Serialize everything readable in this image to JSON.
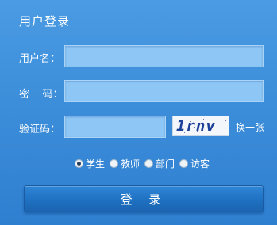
{
  "form": {
    "title": "用户登录",
    "username_label": "用户名：",
    "username_value": "",
    "password_label": "密    码：",
    "password_value": "",
    "captcha_label": "验证码：",
    "captcha_value": "",
    "captcha_text": "1rnv",
    "refresh_label": "换一张",
    "roles": [
      {
        "label": "学生",
        "checked": true
      },
      {
        "label": "教师",
        "checked": false
      },
      {
        "label": "部门",
        "checked": false
      },
      {
        "label": "访客",
        "checked": false
      }
    ],
    "login_label": "登 录"
  },
  "colors": {
    "panel": "#3d8fda",
    "field": "#8ec6f5",
    "button": "#1e6fc0",
    "text": "#ffffff"
  }
}
